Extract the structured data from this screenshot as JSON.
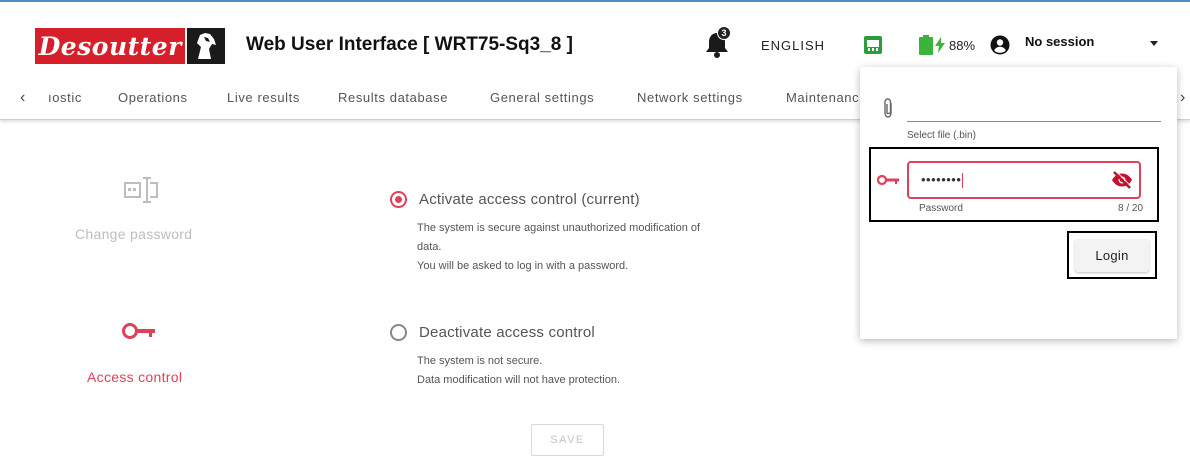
{
  "header": {
    "logo_text": "Desoutter",
    "title": "Web User Interface [ WRT75-Sq3_8 ]",
    "notification_count": "3",
    "language": "ENGLISH",
    "battery_percent": "88%",
    "session": "No session",
    "icons": {
      "bell": "bell-icon",
      "network": "network-icon",
      "battery": "battery-charging-icon",
      "account": "account-circle-icon",
      "caret": "chevron-down-icon"
    }
  },
  "tabs": {
    "items": [
      {
        "label": "ıostic"
      },
      {
        "label": "Operations"
      },
      {
        "label": "Live results"
      },
      {
        "label": "Results database"
      },
      {
        "label": "General settings"
      },
      {
        "label": "Network settings"
      },
      {
        "label": "Maintenanc"
      }
    ],
    "prev_arrow": "‹",
    "next_arrow": "›"
  },
  "left_menu": {
    "change_password": "Change password",
    "access_control": "Access control"
  },
  "options": {
    "activate": {
      "title": "Activate access control (current)",
      "desc_lines": [
        "The system is secure against unauthorized modification of",
        "data.",
        "You will be asked to log in with a password."
      ],
      "selected": true
    },
    "deactivate": {
      "title": "Deactivate access control",
      "desc_lines": [
        "The system is not secure.",
        "Data modification will not have protection."
      ],
      "selected": false
    },
    "save_label": "SAVE"
  },
  "login_popup": {
    "file_label": "Select file (.bin)",
    "password_value": "••••••••",
    "password_label": "Password",
    "password_count": "8 / 20",
    "login_label": "Login"
  },
  "colors": {
    "accent": "#e0415a",
    "brand_red": "#d61f2a",
    "battery_green": "#3cb43c",
    "network_green": "#2e9b3e"
  }
}
